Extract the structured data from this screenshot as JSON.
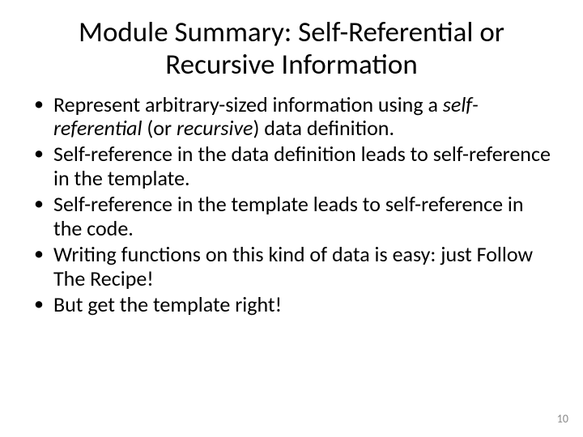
{
  "title": "Module Summary: Self-Referential or Recursive Information",
  "bullets": {
    "b1a": "Represent arbitrary-sized information using a ",
    "b1b": "self-referential",
    "b1c": " (or ",
    "b1d": "recursive",
    "b1e": ") data definition.",
    "b2": "Self-reference in the data definition leads to self-reference in the template.",
    "b3": "Self-reference in the template leads to self-reference in the code.",
    "b4": "Writing functions on this kind of data is easy: just Follow The Recipe!",
    "b5": "But get the template right!"
  },
  "page_number": "10"
}
